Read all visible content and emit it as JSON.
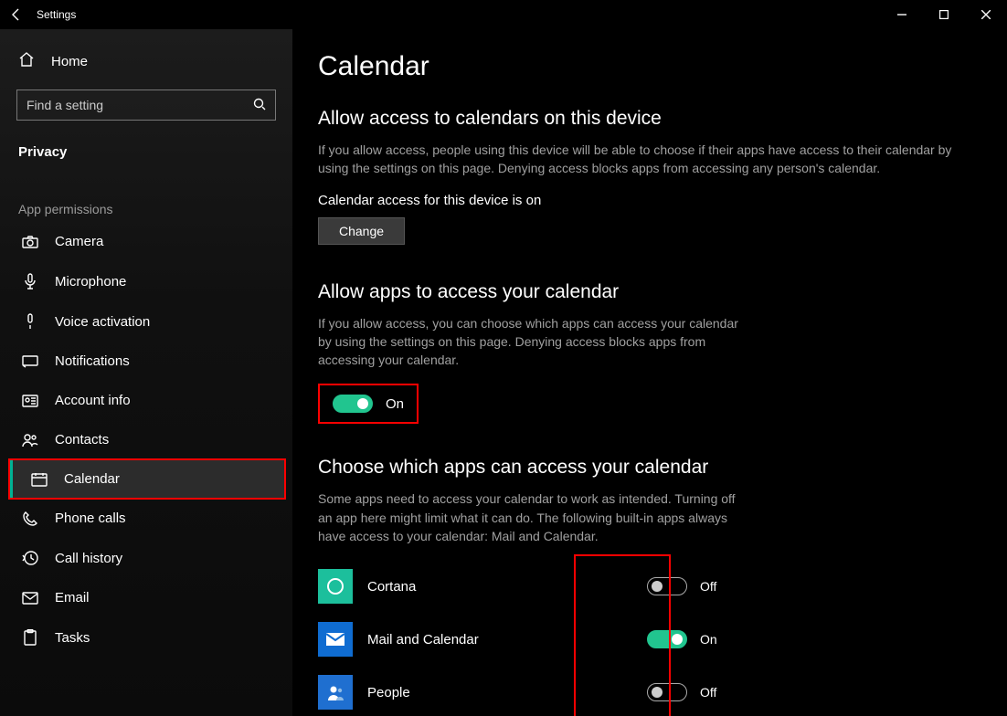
{
  "window": {
    "title": "Settings"
  },
  "sidebar": {
    "home": "Home",
    "search_placeholder": "Find a setting",
    "category": "Privacy",
    "group_label": "App permissions",
    "items": [
      {
        "label": "Camera"
      },
      {
        "label": "Microphone"
      },
      {
        "label": "Voice activation"
      },
      {
        "label": "Notifications"
      },
      {
        "label": "Account info"
      },
      {
        "label": "Contacts"
      },
      {
        "label": "Calendar"
      },
      {
        "label": "Phone calls"
      },
      {
        "label": "Call history"
      },
      {
        "label": "Email"
      },
      {
        "label": "Tasks"
      }
    ]
  },
  "main": {
    "title": "Calendar",
    "section1": {
      "heading": "Allow access to calendars on this device",
      "desc": "If you allow access, people using this device will be able to choose if their apps have access to their calendar by using the settings on this page. Denying access blocks apps from accessing any person's calendar.",
      "status": "Calendar access for this device is on",
      "button": "Change"
    },
    "section2": {
      "heading": "Allow apps to access your calendar",
      "desc": "If you allow access, you can choose which apps can access your calendar by using the settings on this page. Denying access blocks apps from accessing your calendar.",
      "toggle_state": "On"
    },
    "section3": {
      "heading": "Choose which apps can access your calendar",
      "desc": "Some apps need to access your calendar to work as intended. Turning off an app here might limit what it can do. The following built-in apps always have access to your calendar: Mail and Calendar.",
      "apps": [
        {
          "name": "Cortana",
          "state": "Off"
        },
        {
          "name": "Mail and Calendar",
          "state": "On"
        },
        {
          "name": "People",
          "state": "Off"
        }
      ]
    }
  }
}
